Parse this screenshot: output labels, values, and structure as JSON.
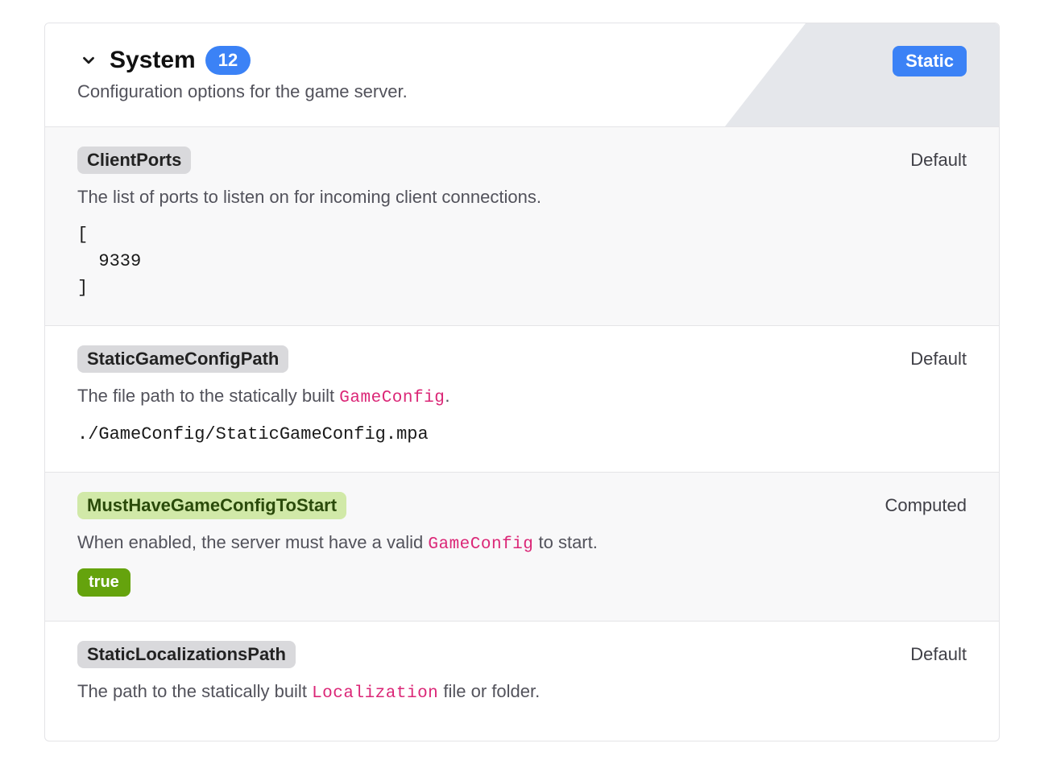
{
  "section": {
    "title": "System",
    "count": "12",
    "subtitle": "Configuration options for the game server.",
    "badge": "Static"
  },
  "items": [
    {
      "name": "ClientPorts",
      "nameStyle": "gray",
      "source": "Default",
      "descPre": "The list of ports to listen on for incoming client connections.",
      "descCode": "",
      "descPost": "",
      "value": "[\n  9339\n]",
      "valueType": "text",
      "alt": true
    },
    {
      "name": "StaticGameConfigPath",
      "nameStyle": "gray",
      "source": "Default",
      "descPre": "The file path to the statically built ",
      "descCode": "GameConfig",
      "descPost": ".",
      "value": "./GameConfig/StaticGameConfig.mpa",
      "valueType": "text",
      "alt": false
    },
    {
      "name": "MustHaveGameConfigToStart",
      "nameStyle": "green",
      "source": "Computed",
      "descPre": "When enabled, the server must have a valid ",
      "descCode": "GameConfig",
      "descPost": " to start.",
      "value": "true",
      "valueType": "bool",
      "alt": true
    },
    {
      "name": "StaticLocalizationsPath",
      "nameStyle": "gray",
      "source": "Default",
      "descPre": "The path to the statically built ",
      "descCode": "Localization",
      "descPost": " file or folder.",
      "value": "",
      "valueType": "none",
      "alt": false
    }
  ]
}
